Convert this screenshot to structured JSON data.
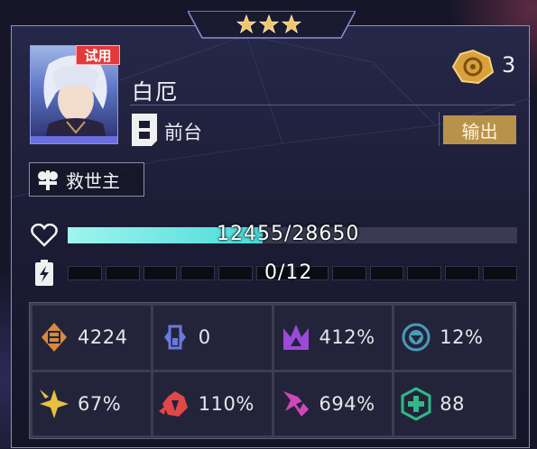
{
  "header": {
    "rarity_stars": 3
  },
  "character": {
    "trial_badge": "试用",
    "name": "白厄",
    "position_label": "前台",
    "role_badge": "输出",
    "eidolon_count": "3",
    "path_label": "救世主"
  },
  "hp": {
    "text": "12455/28650",
    "current": 12455,
    "max": 28650
  },
  "energy": {
    "text": "0/12",
    "current": 0,
    "max": 12
  },
  "stats": [
    {
      "icon": "attack-icon",
      "value": "4224",
      "color": "#d98a3a"
    },
    {
      "icon": "defense-icon",
      "value": "0",
      "color": "#6a78e0"
    },
    {
      "icon": "effect-hit-icon",
      "value": "412%",
      "color": "#9a4ad8"
    },
    {
      "icon": "effect-res-icon",
      "value": "12%",
      "color": "#4a9ab8"
    },
    {
      "icon": "crit-rate-icon",
      "value": "67%",
      "color": "#e8c040"
    },
    {
      "icon": "crit-dmg-icon",
      "value": "110%",
      "color": "#e04848"
    },
    {
      "icon": "break-effect-icon",
      "value": "694%",
      "color": "#d048b8"
    },
    {
      "icon": "healing-icon",
      "value": "88",
      "color": "#30b888"
    }
  ]
}
